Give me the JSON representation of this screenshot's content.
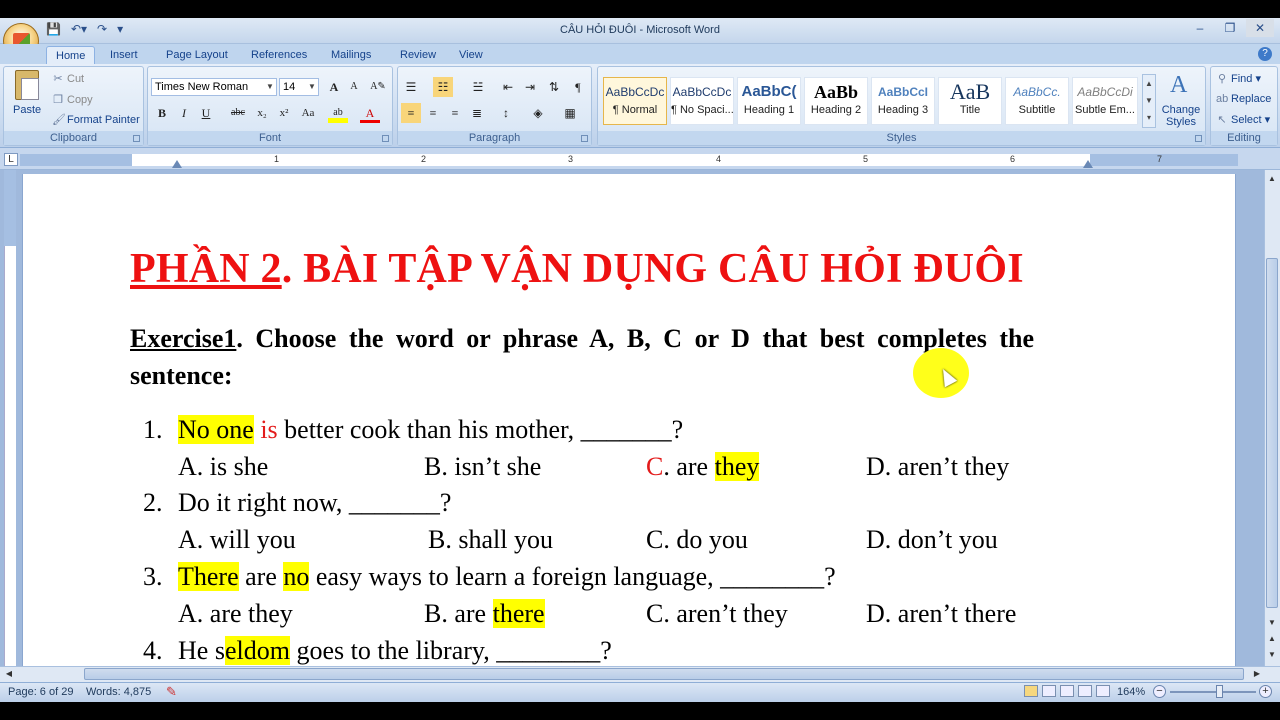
{
  "window": {
    "title": "CÂU HỎI ĐUÔI - Microsoft Word",
    "controls": [
      "–",
      "❐",
      "✕"
    ]
  },
  "ribbon_tabs": [
    "Home",
    "Insert",
    "Page Layout",
    "References",
    "Mailings",
    "Review",
    "View"
  ],
  "clipboard": {
    "paste": "Paste",
    "cut": "Cut",
    "copy": "Copy",
    "format_painter": "Format Painter",
    "label": "Clipboard"
  },
  "font": {
    "name": "Times New Roman",
    "size": "14",
    "label": "Font",
    "bold": "B",
    "italic": "I",
    "underline": "U",
    "strike": "abc",
    "sub": "x₂",
    "sup": "x²",
    "case": "Aa",
    "grow": "A",
    "shrink": "A"
  },
  "paragraph": {
    "label": "Paragraph"
  },
  "styles": {
    "label": "Styles",
    "items": [
      {
        "sample": "AaBbCcDc",
        "name": "¶ Normal"
      },
      {
        "sample": "AaBbCcDc",
        "name": "¶ No Spaci..."
      },
      {
        "sample": "AaBbC(",
        "name": "Heading 1"
      },
      {
        "sample": "AaBb",
        "name": "Heading 2"
      },
      {
        "sample": "AaBbCcI",
        "name": "Heading 3"
      },
      {
        "sample": "AaB",
        "name": "Title"
      },
      {
        "sample": "AaBbCc.",
        "name": "Subtitle"
      },
      {
        "sample": "AaBbCcDi",
        "name": "Subtle Em..."
      }
    ],
    "change_styles": "Change Styles"
  },
  "editing": {
    "label": "Editing",
    "find": "Find",
    "replace": "Replace",
    "select": "Select"
  },
  "ruler": {
    "numbers": [
      "1",
      "2",
      "3",
      "4",
      "5",
      "6",
      "7"
    ],
    "corner": "L"
  },
  "document": {
    "heading_part1": "PHẦN 2",
    "heading_part2": ". BÀI TẬP VẬN DỤNG CÂU HỎI ĐUÔI",
    "exercise_label": "Exercise1",
    "exercise_text": ". Choose the word or phrase A, B, C or D that best completes the sentence:",
    "q1": {
      "num": "1.",
      "hl1": "No one",
      "red": "is",
      "rest": " better cook than his mother, _______?",
      "a": "A. is she",
      "b": "B. isn’t she",
      "c_letter": "C",
      "c_mid": ". are ",
      "c_hl": "they",
      "d": "D. aren’t they"
    },
    "q2": {
      "num": "2.",
      "text": "Do it right now, _______?",
      "a": "A. will you",
      "b": "B. shall you",
      "c": "C. do you",
      "d": "D. don’t you"
    },
    "q3": {
      "num": "3.",
      "hl1": "There",
      "mid1": " are ",
      "hl2": "no",
      "rest": " easy ways to learn a foreign language, ________?",
      "a": "A. are they",
      "b_pre": "B. are ",
      "b_hl": "there",
      "c": "C. aren’t they",
      "d": "D. aren’t there"
    },
    "q4": {
      "num": "4.",
      "pre": "He s",
      "hl": "eldom",
      "rest": " goes to the library, ________?"
    }
  },
  "status": {
    "page": "Page: 6 of 29",
    "words": "Words: 4,875",
    "zoom": "164%"
  }
}
